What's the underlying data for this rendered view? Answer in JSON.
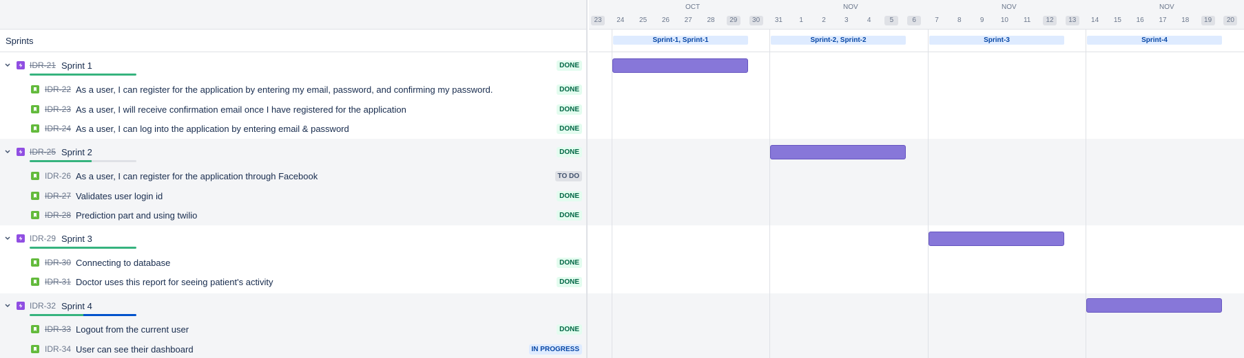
{
  "header": {
    "sprints_label": "Sprints"
  },
  "timeline": {
    "months": [
      "OCT",
      "NOV",
      "NOV",
      "NOV"
    ],
    "days": [
      "23",
      "24",
      "25",
      "26",
      "27",
      "28",
      "29",
      "30",
      "31",
      "1",
      "2",
      "3",
      "4",
      "5",
      "6",
      "7",
      "8",
      "9",
      "10",
      "11",
      "12",
      "13",
      "14",
      "15",
      "16",
      "17",
      "18",
      "19",
      "20"
    ],
    "sprint_pills": [
      "Sprint-1, Sprint-1",
      "Sprint-2, Sprint-2",
      "Sprint-3",
      "Sprint-4"
    ]
  },
  "colors": {
    "epic": "#904ee2",
    "story": "#63ba3c",
    "bar": "#8777d9",
    "done_progress": "#36b37e",
    "inprogress_progress": "#0052cc"
  },
  "epics": [
    {
      "key": "IDR-21",
      "title": "Sprint 1",
      "status": "DONE",
      "progress_done": 1.0,
      "progress_inprogress": 0.0,
      "stories": [
        {
          "key": "IDR-22",
          "title": "As a user, I can register for the application by entering my email, password, and confirming my password.",
          "status": "DONE"
        },
        {
          "key": "IDR-23",
          "title": "As a user, I will receive confirmation email once I have registered for the application",
          "status": "DONE"
        },
        {
          "key": "IDR-24",
          "title": "As a user, I can log into the application by entering email & password",
          "status": "DONE"
        }
      ]
    },
    {
      "key": "IDR-25",
      "title": "Sprint 2",
      "status": "DONE",
      "progress_done": 0.58,
      "progress_inprogress": 0.0,
      "stories": [
        {
          "key": "IDR-26",
          "title": "As a user, I can register for the application through Facebook",
          "status": "TO DO"
        },
        {
          "key": "IDR-27",
          "title": "Validates user login id",
          "status": "DONE"
        },
        {
          "key": "IDR-28",
          "title": "Prediction part and using twilio",
          "status": "DONE"
        }
      ]
    },
    {
      "key": "IDR-29",
      "title": "Sprint 3",
      "status": "",
      "progress_done": 1.0,
      "progress_inprogress": 0.0,
      "stories": [
        {
          "key": "IDR-30",
          "title": "Connecting to database",
          "status": "DONE"
        },
        {
          "key": "IDR-31",
          "title": "Doctor uses this report for seeing patient's activity",
          "status": "DONE"
        }
      ]
    },
    {
      "key": "IDR-32",
      "title": "Sprint 4",
      "status": "",
      "progress_done": 0.5,
      "progress_inprogress": 0.5,
      "stories": [
        {
          "key": "IDR-33",
          "title": "Logout from the current user",
          "status": "DONE"
        },
        {
          "key": "IDR-34",
          "title": "User can see their dashboard",
          "status": "IN PROGRESS"
        }
      ]
    }
  ]
}
